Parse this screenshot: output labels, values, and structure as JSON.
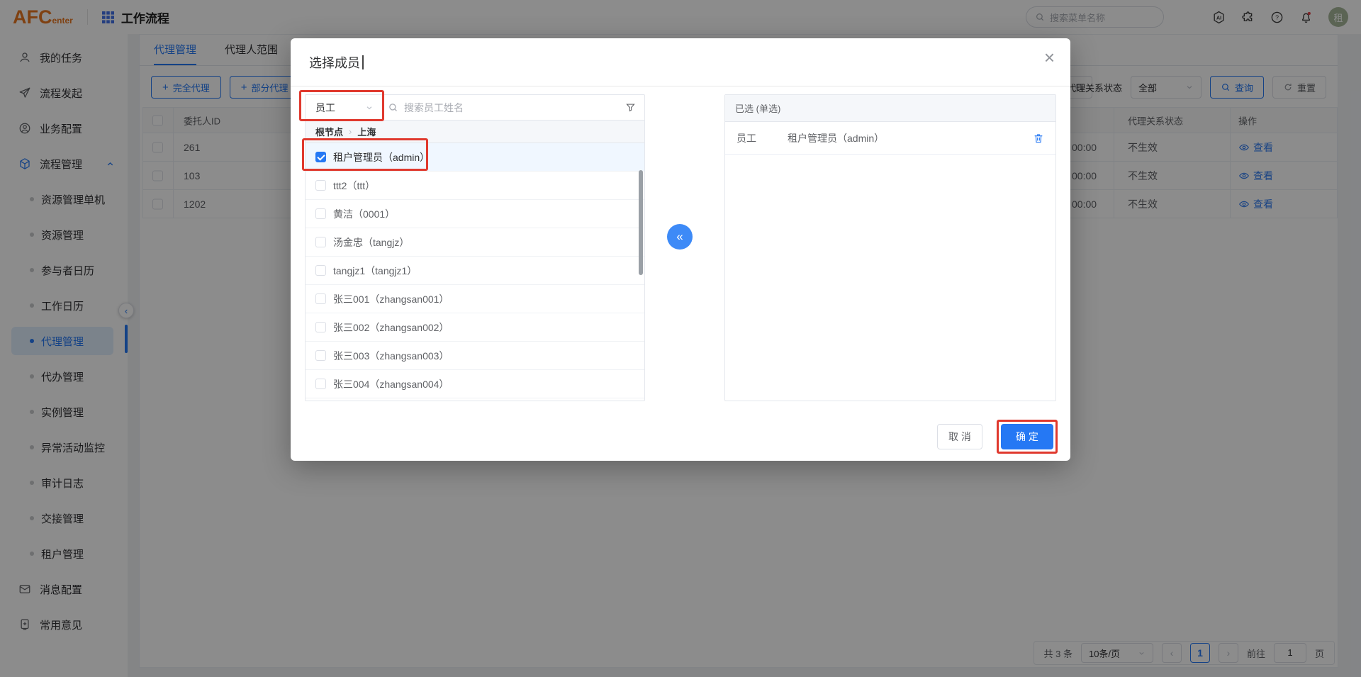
{
  "colors": {
    "accent": "#2578f4",
    "accent_light": "#3d8af7",
    "annotation_red": "#e0392e",
    "logo_orange": "#e87722",
    "grid_blue": "#4272e8",
    "avatar_bg": "#a7b69a",
    "notification_dot": "#e5484d"
  },
  "header": {
    "logo": "AFC",
    "logo_sub": "enter",
    "app_title": "工作流程",
    "search_placeholder": "搜索菜单名称",
    "ai_badge": "AI",
    "help_mark": "?",
    "avatar": "租"
  },
  "sidebar": {
    "items": [
      {
        "label": "我的任务",
        "type": "top",
        "icon": "user"
      },
      {
        "label": "流程发起",
        "type": "top",
        "icon": "send"
      },
      {
        "label": "业务配置",
        "type": "top",
        "icon": "usercircle"
      },
      {
        "label": "流程管理",
        "type": "top",
        "icon": "cube",
        "expanded": true
      },
      {
        "label": "资源管理单机",
        "type": "sub"
      },
      {
        "label": "资源管理",
        "type": "sub"
      },
      {
        "label": "参与者日历",
        "type": "sub"
      },
      {
        "label": "工作日历",
        "type": "sub"
      },
      {
        "label": "代理管理",
        "type": "sub",
        "active": true
      },
      {
        "label": "代办管理",
        "type": "sub"
      },
      {
        "label": "实例管理",
        "type": "sub"
      },
      {
        "label": "异常活动监控",
        "type": "sub"
      },
      {
        "label": "审计日志",
        "type": "sub"
      },
      {
        "label": "交接管理",
        "type": "sub"
      },
      {
        "label": "租户管理",
        "type": "sub"
      },
      {
        "label": "消息配置",
        "type": "top",
        "icon": "mail"
      },
      {
        "label": "常用意见",
        "type": "top",
        "icon": "bookmark"
      }
    ]
  },
  "main": {
    "tabs": [
      {
        "label": "代理管理",
        "active": true
      },
      {
        "label": "代理人范围",
        "active": false
      }
    ],
    "toolbar": {
      "plus": "+",
      "buttons": [
        "完全代理",
        "部分代理"
      ],
      "filter_label": "代理关系状态",
      "filter_value": "全部",
      "query": "查询",
      "reset": "重置"
    },
    "table": {
      "headers": {
        "owner": "委托人ID",
        "status": "代理关系状态",
        "action": "操作"
      },
      "rows": [
        {
          "id": "261",
          "time": "00:00",
          "status": "不生效",
          "action": "查看"
        },
        {
          "id": "103",
          "time": "00:00",
          "status": "不生效",
          "action": "查看"
        },
        {
          "id": "1202",
          "time": "00:00",
          "status": "不生效",
          "action": "查看"
        }
      ]
    },
    "pagination": {
      "total": "共 3 条",
      "size": "10条/页",
      "prev": "‹",
      "page": "1",
      "next": "›",
      "goto_label": "前往",
      "goto_value": "1",
      "unit": "页"
    }
  },
  "modal": {
    "title": "选择成员",
    "close": "×",
    "transfer": "«",
    "left": {
      "type_value": "员工",
      "search_placeholder": "搜索员工姓名",
      "crumb_root": "根节点",
      "crumb_sep": "›",
      "crumb_current": "上海",
      "members": [
        {
          "label": "租户管理员（admin）",
          "checked": true,
          "annotated": true
        },
        {
          "label": "ttt2（ttt）"
        },
        {
          "label": "黄洁（0001）"
        },
        {
          "label": "汤金忠（tangjz）"
        },
        {
          "label": "tangjz1（tangjz1）"
        },
        {
          "label": "张三001（zhangsan001）"
        },
        {
          "label": "张三002（zhangsan002）"
        },
        {
          "label": "张三003（zhangsan003）"
        },
        {
          "label": "张三004（zhangsan004）"
        }
      ]
    },
    "right": {
      "header": "已选 (单选)",
      "sel_type": "员工",
      "sel_name": "租户管理员（admin）"
    },
    "footer": {
      "cancel": "取 消",
      "ok": "确 定"
    }
  }
}
